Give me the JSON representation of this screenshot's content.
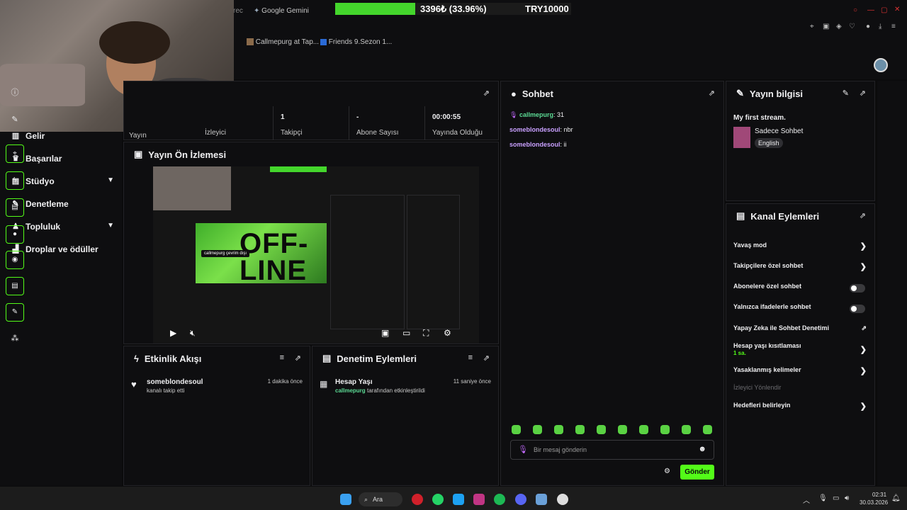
{
  "browser": {
    "tab_fragment": "rec",
    "tab_gemini": "Google Gemini",
    "bookmark1": "Callmepurg at Tap...",
    "bookmark2": "Friends 9.Sezon 1...",
    "progress_text": "3396₺ (33.96%)",
    "progress_fraction": 0.3396,
    "goal_text": "TRY10000",
    "accent": "#44d62c"
  },
  "sidebar": {
    "items": [
      {
        "label": "Gelir",
        "icon": "chart-icon"
      },
      {
        "label": "Başarılar",
        "icon": "trophy-icon"
      },
      {
        "label": "Stüdyo",
        "icon": "studio-icon",
        "expandable": true
      },
      {
        "label": "Denetleme",
        "icon": "wrench-icon"
      },
      {
        "label": "Topluluk",
        "icon": "community-icon",
        "expandable": true
      },
      {
        "label": "Droplar ve ödüller",
        "icon": "drops-icon"
      }
    ]
  },
  "stats": {
    "partial_label1": "Yayın",
    "partial_label2": "İzleyici",
    "followers_value": "1",
    "followers_label": "Takipçi",
    "subs_value": "-",
    "subs_label": "Abone Sayısı",
    "uptime_value": "00:00:55",
    "uptime_label": "Yayında Olduğu"
  },
  "preview": {
    "title": "Yayın Ön İzlemesi",
    "offline_text1": "OFF-",
    "offline_text2": "LINE",
    "badge": "callmepurg çevrim dışı"
  },
  "activity": {
    "title": "Etkinlik Akışı",
    "items": [
      {
        "user": "someblondesoul",
        "detail": "kanalı takip etti",
        "time": "1 dakika önce"
      }
    ]
  },
  "moderation": {
    "title": "Denetim Eylemleri",
    "items": [
      {
        "title": "Hesap Yaşı",
        "actor": "callmepurg",
        "detail": "tarafından etkinleştirildi",
        "time": "11 saniye önce"
      }
    ]
  },
  "chat": {
    "title": "Sohbet",
    "messages": [
      {
        "user": "callmepurg",
        "text": ": 31"
      },
      {
        "user": "someblondesoul",
        "text": ": nbr"
      },
      {
        "user": "someblondesoul",
        "text": ": ii"
      }
    ],
    "placeholder": "Bir mesaj gönderin",
    "send_label": "Gönder"
  },
  "stream_info": {
    "title": "Yayın bilgisi",
    "stream_title": "My first stream.",
    "category": "Sadece Sohbet",
    "language": "English"
  },
  "channel_actions": {
    "title": "Kanal Eylemleri",
    "items": [
      {
        "label": "Yavaş mod",
        "kind": "chevron"
      },
      {
        "label": "Takipçilere özel sohbet",
        "kind": "chevron"
      },
      {
        "label": "Abonelere özel sohbet",
        "kind": "toggle",
        "on": false
      },
      {
        "label": "Yalnızca ifadelerle sohbet",
        "kind": "toggle",
        "on": false
      },
      {
        "label": "Yapay Zeka ile Sohbet Denetimi",
        "kind": "external"
      },
      {
        "label": "Hesap yaşı kısıtlaması",
        "sub": "1 sa.",
        "kind": "chevron"
      },
      {
        "label": "Yasaklanmış kelimeler",
        "kind": "chevron"
      },
      {
        "label": "İzleyici Yönlendir",
        "kind": "disabled"
      },
      {
        "label": "Hedefleri belirleyin",
        "kind": "chevron"
      }
    ]
  },
  "taskbar": {
    "search": "Ara",
    "time": "02:31",
    "date": "30.03.2026"
  }
}
